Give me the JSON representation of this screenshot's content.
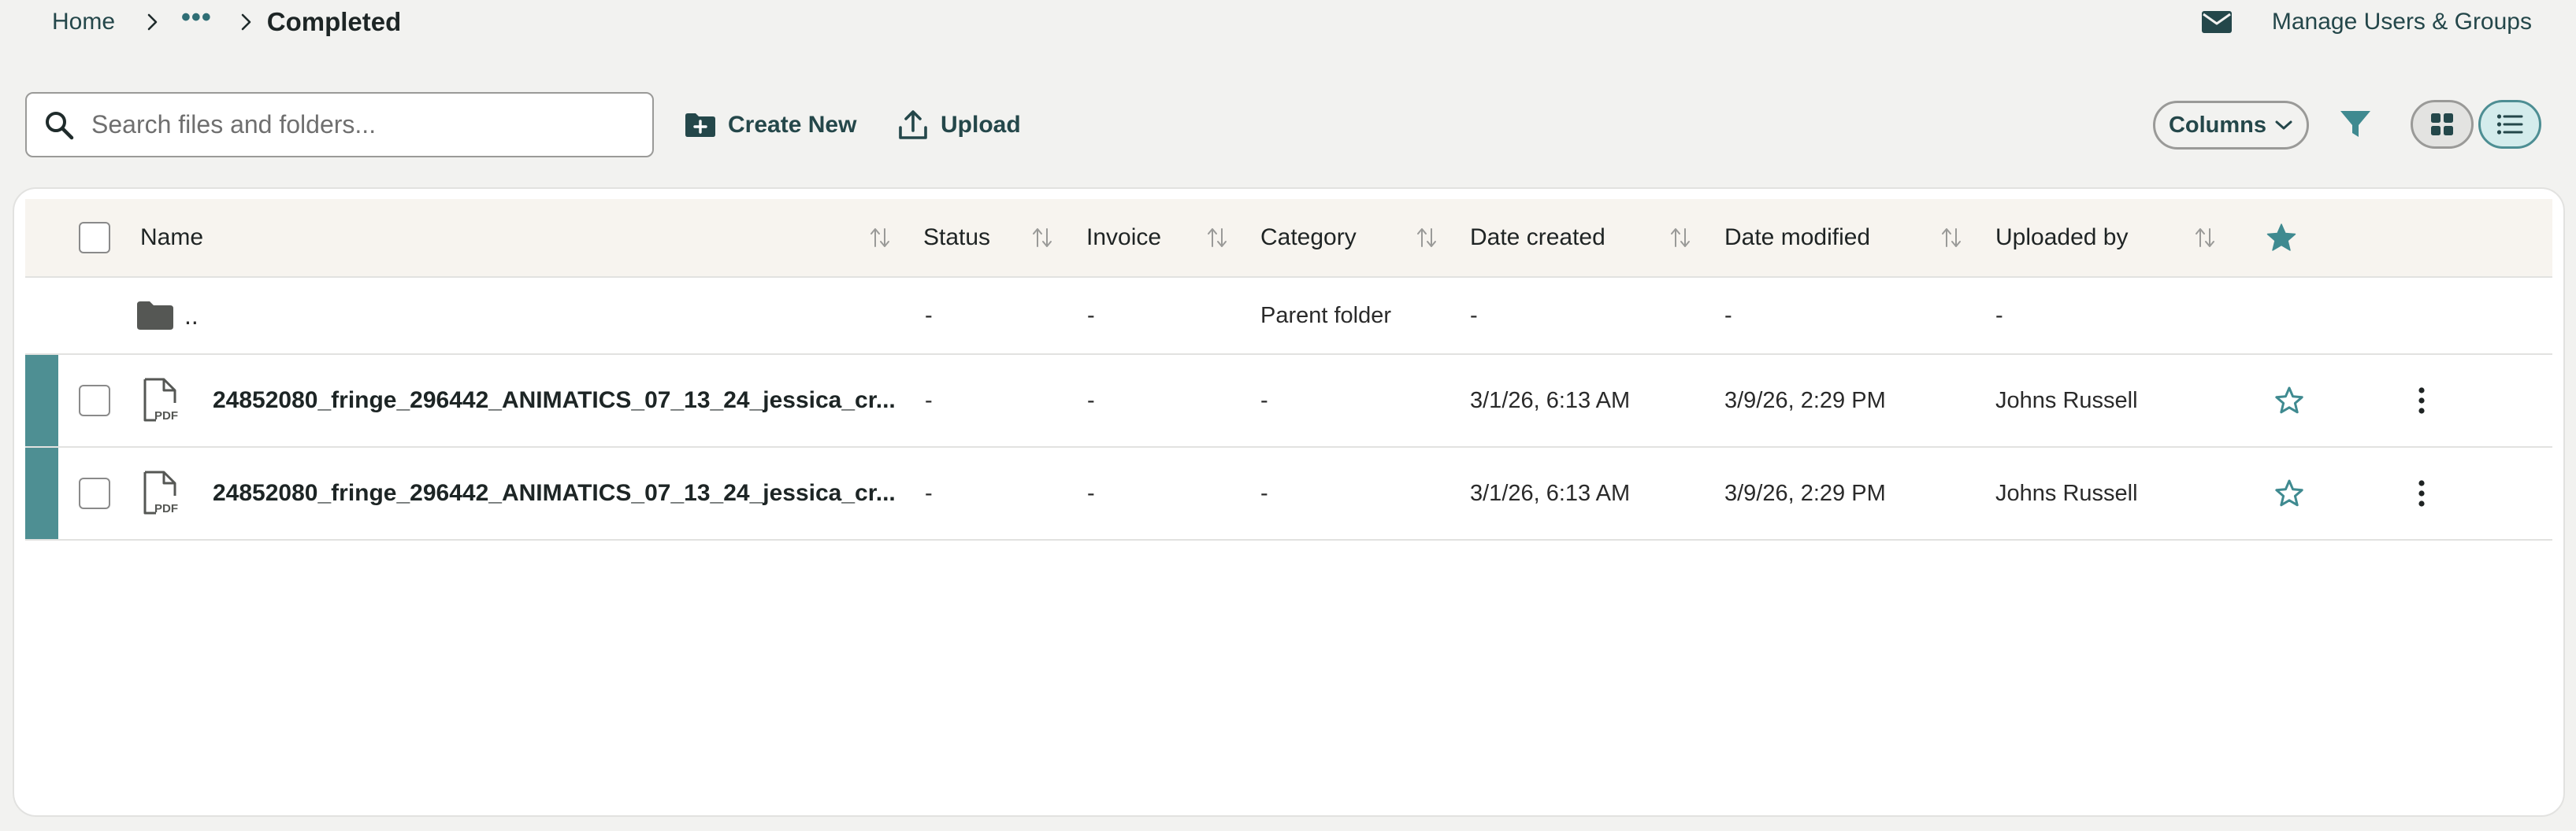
{
  "breadcrumb": {
    "home": "Home",
    "more": "•••",
    "current": "Completed"
  },
  "header": {
    "manage_label": "Manage Users & Groups"
  },
  "toolbar": {
    "search_placeholder": "Search files and folders...",
    "create_label": "Create New",
    "upload_label": "Upload",
    "columns_label": "Columns"
  },
  "table": {
    "columns": {
      "name": "Name",
      "status": "Status",
      "invoice": "Invoice",
      "category": "Category",
      "date_created": "Date created",
      "date_modified": "Date modified",
      "uploaded_by": "Uploaded by"
    },
    "parent": {
      "name": "..",
      "status": "-",
      "invoice": "-",
      "category": "Parent folder",
      "date_created": "-",
      "date_modified": "-",
      "uploaded_by": "-"
    },
    "rows": [
      {
        "name": "24852080_fringe_296442_ANIMATICS_07_13_24_jessica_cr...",
        "status": "-",
        "invoice": "-",
        "category": "-",
        "date_created": "3/1/26, 6:13 AM",
        "date_modified": "3/9/26, 2:29 PM",
        "uploaded_by": "Johns Russell"
      },
      {
        "name": "24852080_fringe_296442_ANIMATICS_07_13_24_jessica_cr...",
        "status": "-",
        "invoice": "-",
        "category": "-",
        "date_created": "3/1/26, 6:13 AM",
        "date_modified": "3/9/26, 2:29 PM",
        "uploaded_by": "Johns Russell"
      }
    ]
  },
  "icons": {
    "mail": "mail-icon",
    "search": "search-icon",
    "create": "folder-plus-icon",
    "upload": "upload-icon",
    "filter": "filter-icon",
    "grid": "grid-view-icon",
    "list": "list-view-icon",
    "star": "star-icon",
    "pdf": "pdf-file-icon",
    "folder": "folder-icon",
    "kebab": "more-vertical-icon"
  },
  "colors": {
    "accent": "#4e8f93",
    "brand_text": "#24474a",
    "background": "#f2f2f0",
    "header_row": "#f7f4ef"
  }
}
